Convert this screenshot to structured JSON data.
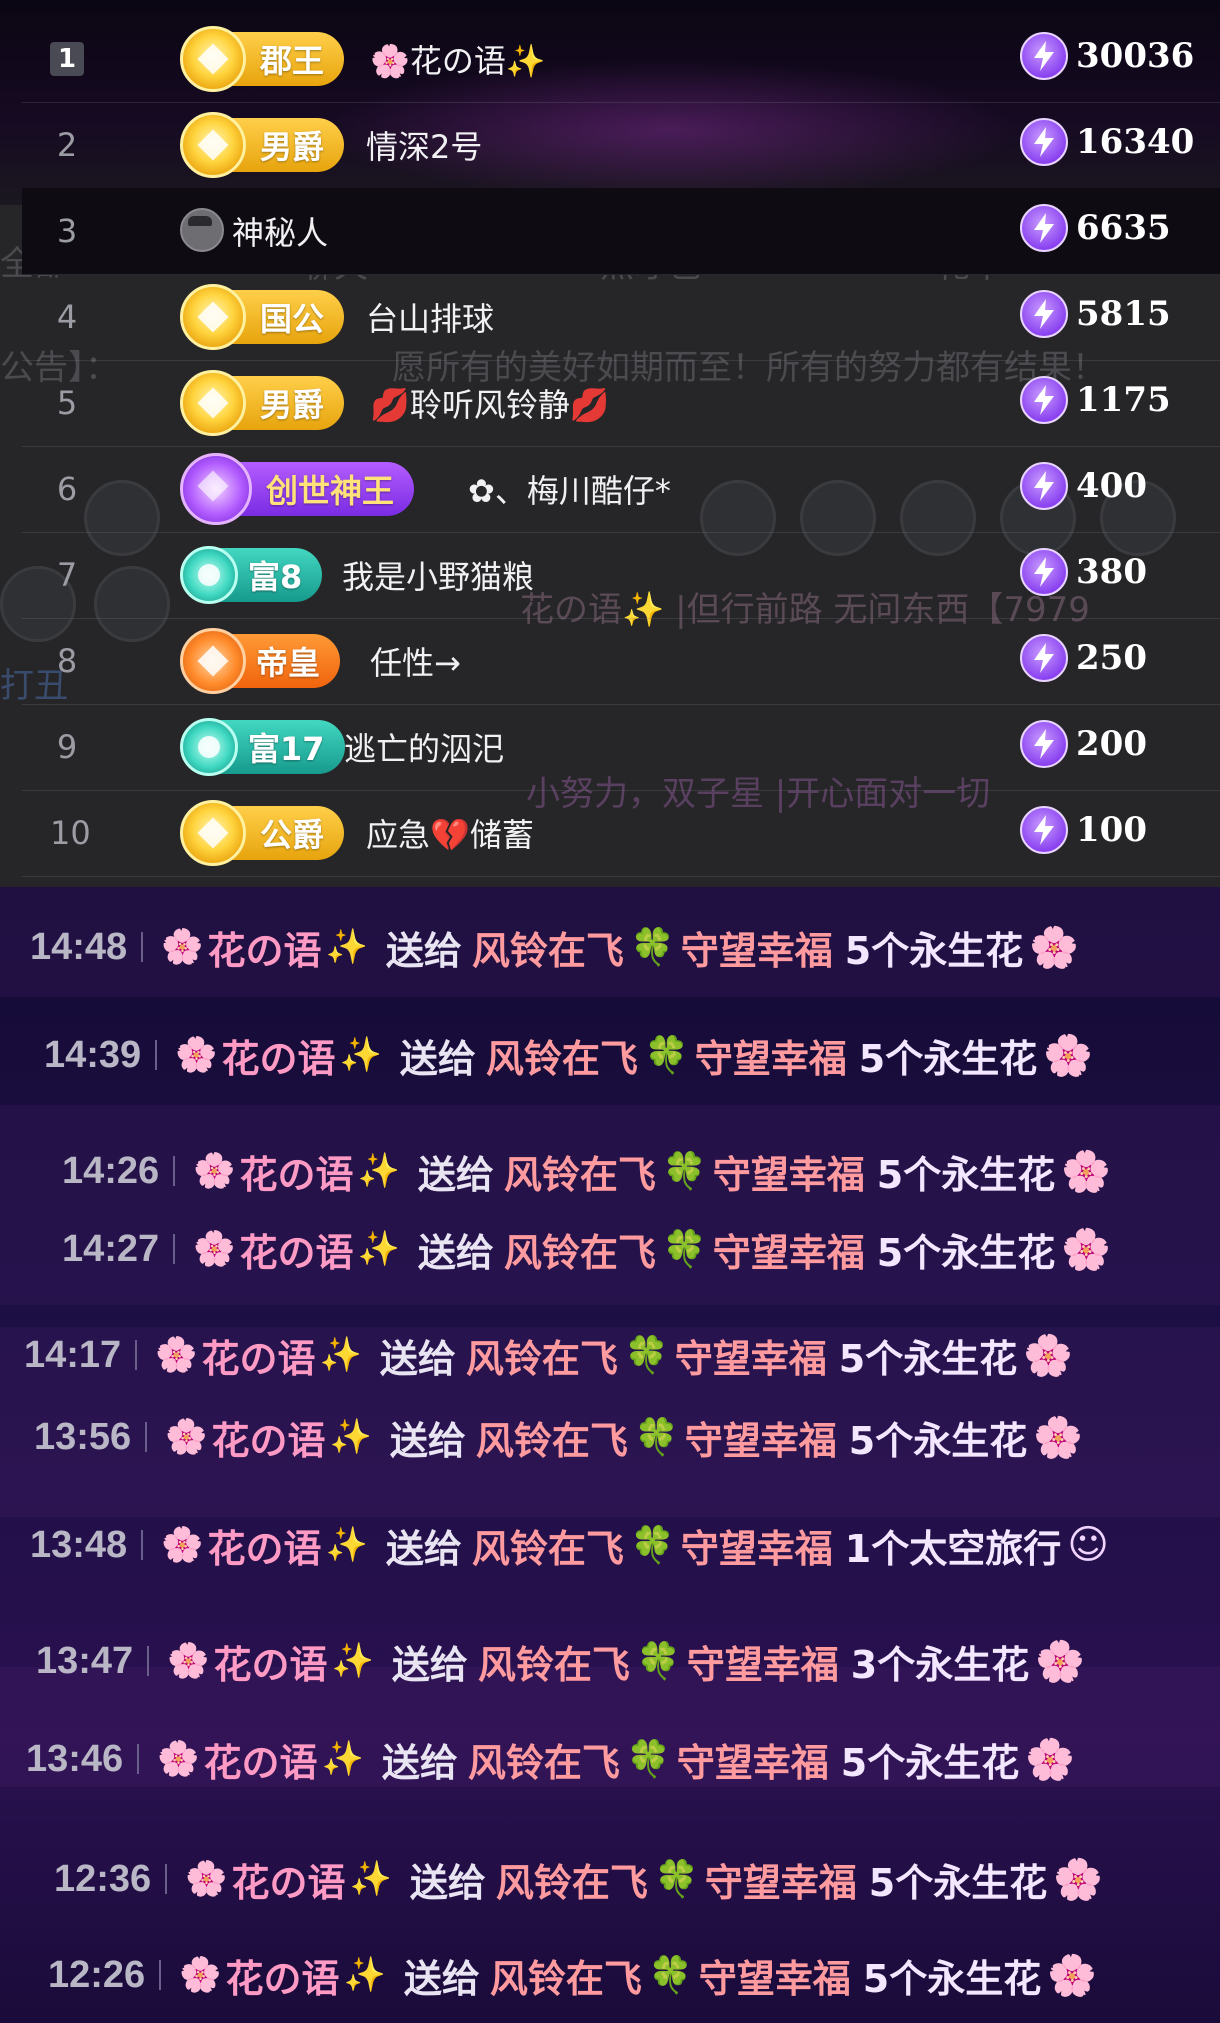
{
  "background_tabs": {
    "all": "全部",
    "chat": "聊天",
    "talent": "点才艺",
    "gift": "礼单",
    "announcement": "公告】：",
    "announcement_text": "愿所有的美好如期而至！所有的努力都有结果！",
    "chat_line1": "花の语✨  |但行前路 无问东西【7979",
    "chat_line2": "小努力，双子星  |开心面对一切",
    "clown": "打丑"
  },
  "leaderboard": [
    {
      "rank": "1",
      "badge": "郡王",
      "badge_style": "gold",
      "name": "🌸花の语✨",
      "score": "30036"
    },
    {
      "rank": "2",
      "badge": "男爵",
      "badge_style": "gold",
      "name": "情深2号",
      "score": "16340"
    },
    {
      "rank": "3",
      "badge": "",
      "badge_style": "none",
      "name": "神秘人",
      "score": "6635"
    },
    {
      "rank": "4",
      "badge": "国公",
      "badge_style": "gold",
      "name": "台山排球",
      "score": "5815"
    },
    {
      "rank": "5",
      "badge": "男爵",
      "badge_style": "gold",
      "name": "💋聆听风铃静💋",
      "score": "1175"
    },
    {
      "rank": "6",
      "badge": "创世神王",
      "badge_style": "purple",
      "name": "✿、梅川酷仔*",
      "score": "400"
    },
    {
      "rank": "7",
      "badge": "富8",
      "badge_style": "teal",
      "name": "我是小野猫粮",
      "score": "380"
    },
    {
      "rank": "8",
      "badge": "帝皇",
      "badge_style": "orange",
      "name": "任性→",
      "score": "250"
    },
    {
      "rank": "9",
      "badge": "富17",
      "badge_style": "teal",
      "name": "逃亡的泅汜",
      "score": "200"
    },
    {
      "rank": "10",
      "badge": "公爵",
      "badge_style": "gold",
      "name": "应急💔储蓄",
      "score": "100"
    }
  ],
  "gift_feed": [
    {
      "time": "14:48",
      "sender": "花の语",
      "verb": "送给",
      "recipient": "风铃在飞",
      "recipient2": "守望幸福",
      "gift": "5个永生花"
    },
    {
      "time": "14:39",
      "sender": "花の语",
      "verb": "送给",
      "recipient": "风铃在飞",
      "recipient2": "守望幸福",
      "gift": "5个永生花"
    },
    {
      "time": "14:26",
      "sender": "花の语",
      "verb": "送给",
      "recipient": "风铃在飞",
      "recipient2": "守望幸福",
      "gift": "5个永生花"
    },
    {
      "time": "14:27",
      "sender": "花の语",
      "verb": "送给",
      "recipient": "风铃在飞",
      "recipient2": "守望幸福",
      "gift": "5个永生花"
    },
    {
      "time": "14:17",
      "sender": "花の语",
      "verb": "送给",
      "recipient": "风铃在飞",
      "recipient2": "守望幸福",
      "gift": "5个永生花"
    },
    {
      "time": "13:56",
      "sender": "花の语",
      "verb": "送给",
      "recipient": "风铃在飞",
      "recipient2": "守望幸福",
      "gift": "5个永生花"
    },
    {
      "time": "13:48",
      "sender": "花の语",
      "verb": "送给",
      "recipient": "风铃在飞",
      "recipient2": "守望幸福",
      "gift": "1个太空旅行"
    },
    {
      "time": "13:47",
      "sender": "花の语",
      "verb": "送给",
      "recipient": "风铃在飞",
      "recipient2": "守望幸福",
      "gift": "3个永生花"
    },
    {
      "time": "13:46",
      "sender": "花の语",
      "verb": "送给",
      "recipient": "风铃在飞",
      "recipient2": "守望幸福",
      "gift": "5个永生花"
    },
    {
      "time": "12:36",
      "sender": "花の语",
      "verb": "送给",
      "recipient": "风铃在飞",
      "recipient2": "守望幸福",
      "gift": "5个永生花"
    },
    {
      "time": "12:26",
      "sender": "花の语",
      "verb": "送给",
      "recipient": "风铃在飞",
      "recipient2": "守望幸福",
      "gift": "5个永生花"
    }
  ],
  "icons": {
    "flower": "🌸",
    "sparkle": "✨",
    "clover": "🍀",
    "bolt": "lightning-bolt-icon",
    "gift_flower": "🌸"
  },
  "colors": {
    "gold_badge": "#f2b320",
    "purple_badge": "#8f3cf0",
    "teal_badge": "#27b5a5",
    "orange_badge": "#f57a1f",
    "score_coin": "#9c5bff",
    "feed_pink": "#ff9ac4",
    "feed_bg": "#1d0f44"
  }
}
